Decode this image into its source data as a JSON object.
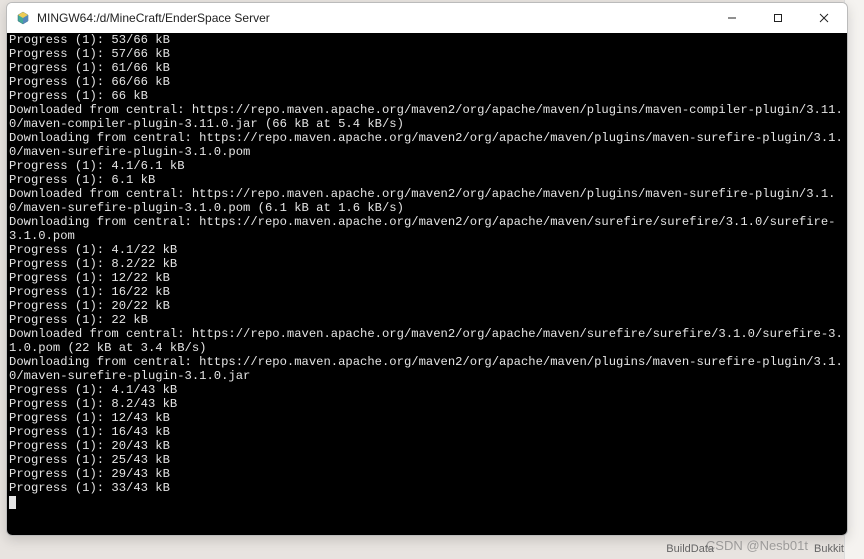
{
  "window": {
    "title": "MINGW64:/d/MineCraft/EnderSpace Server"
  },
  "terminal": {
    "lines": [
      "Progress (1): 53/66 kB",
      "Progress (1): 57/66 kB",
      "Progress (1): 61/66 kB",
      "Progress (1): 66/66 kB",
      "Progress (1): 66 kB",
      "",
      "Downloaded from central: https://repo.maven.apache.org/maven2/org/apache/maven/plugins/maven-compiler-plugin/3.11.0/maven-compiler-plugin-3.11.0.jar (66 kB at 5.4 kB/s)",
      "Downloading from central: https://repo.maven.apache.org/maven2/org/apache/maven/plugins/maven-surefire-plugin/3.1.0/maven-surefire-plugin-3.1.0.pom",
      "Progress (1): 4.1/6.1 kB",
      "Progress (1): 6.1 kB",
      "",
      "Downloaded from central: https://repo.maven.apache.org/maven2/org/apache/maven/plugins/maven-surefire-plugin/3.1.0/maven-surefire-plugin-3.1.0.pom (6.1 kB at 1.6 kB/s)",
      "Downloading from central: https://repo.maven.apache.org/maven2/org/apache/maven/surefire/surefire/3.1.0/surefire-3.1.0.pom",
      "Progress (1): 4.1/22 kB",
      "Progress (1): 8.2/22 kB",
      "Progress (1): 12/22 kB",
      "Progress (1): 16/22 kB",
      "Progress (1): 20/22 kB",
      "Progress (1): 22 kB",
      "",
      "Downloaded from central: https://repo.maven.apache.org/maven2/org/apache/maven/surefire/surefire/3.1.0/surefire-3.1.0.pom (22 kB at 3.4 kB/s)",
      "Downloading from central: https://repo.maven.apache.org/maven2/org/apache/maven/plugins/maven-surefire-plugin/3.1.0/maven-surefire-plugin-3.1.0.jar",
      "Progress (1): 4.1/43 kB",
      "Progress (1): 8.2/43 kB",
      "Progress (1): 12/43 kB",
      "Progress (1): 16/43 kB",
      "Progress (1): 20/43 kB",
      "Progress (1): 25/43 kB",
      "Progress (1): 29/43 kB",
      "Progress (1): 33/43 kB"
    ]
  },
  "background": {
    "label1": "BuildData",
    "label2": "Bukkit"
  },
  "watermark": "CSDN @Nesb01t"
}
